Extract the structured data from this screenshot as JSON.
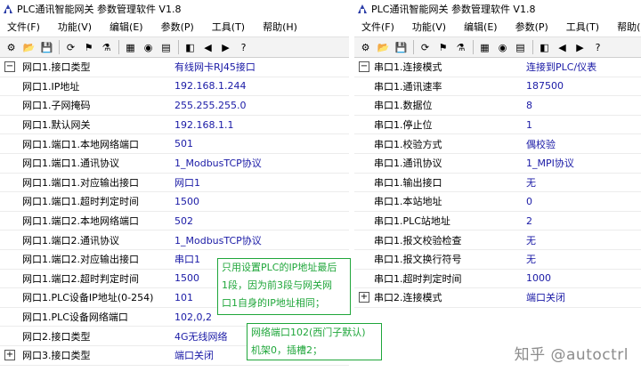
{
  "left": {
    "title": "PLC通讯智能网关 参数管理软件 V1.8",
    "menu": [
      "文件(F)",
      "功能(V)",
      "编辑(E)",
      "参数(P)",
      "工具(T)",
      "帮助(H)"
    ],
    "toolbar": [
      "⚙",
      "📂",
      "💾",
      "⟳",
      "⚑",
      "⚗",
      "▦",
      "◉",
      "▤",
      "◧",
      "◀",
      "▶",
      "?"
    ],
    "rows": [
      {
        "exp": "−",
        "label": "网口1.接口类型",
        "value": "有线网卡RJ45接口"
      },
      {
        "exp": "",
        "label": "网口1.IP地址",
        "value": "192.168.1.244"
      },
      {
        "exp": "",
        "label": "网口1.子网掩码",
        "value": "255.255.255.0"
      },
      {
        "exp": "",
        "label": "网口1.默认网关",
        "value": "192.168.1.1"
      },
      {
        "exp": "",
        "label": "网口1.端口1.本地网络端口",
        "value": "501"
      },
      {
        "exp": "",
        "label": "网口1.端口1.通讯协议",
        "value": "1_ModbusTCP协议"
      },
      {
        "exp": "",
        "label": "网口1.端口1.对应输出接口",
        "value": "网口1"
      },
      {
        "exp": "",
        "label": "网口1.端口1.超时判定时间",
        "value": "1500"
      },
      {
        "exp": "",
        "label": "网口1.端口2.本地网络端口",
        "value": "502"
      },
      {
        "exp": "",
        "label": "网口1.端口2.通讯协议",
        "value": "1_ModbusTCP协议"
      },
      {
        "exp": "",
        "label": "网口1.端口2.对应输出接口",
        "value": "串口1"
      },
      {
        "exp": "",
        "label": "网口1.端口2.超时判定时间",
        "value": "1500"
      },
      {
        "exp": "",
        "label": "网口1.PLC设备IP地址(0-254)",
        "value": "101"
      },
      {
        "exp": "",
        "label": "网口1.PLC设备网络端口",
        "value": "102,0,2"
      },
      {
        "exp": "",
        "label": "网口2.接口类型",
        "value": "4G无线网络"
      },
      {
        "exp": "+",
        "label": "网口3.接口类型",
        "value": "端口关闭"
      }
    ]
  },
  "right": {
    "title": "PLC通讯智能网关 参数管理软件 V1.8",
    "menu": [
      "文件(F)",
      "功能(V)",
      "编辑(E)",
      "参数(P)",
      "工具(T)",
      "帮助(H)"
    ],
    "toolbar": [
      "⚙",
      "📂",
      "💾",
      "⟳",
      "⚑",
      "⚗",
      "▦",
      "◉",
      "▤",
      "◧",
      "◀",
      "▶",
      "?"
    ],
    "rows": [
      {
        "exp": "−",
        "label": "串口1.连接模式",
        "value": "连接到PLC/仪表"
      },
      {
        "exp": "",
        "label": "串口1.通讯速率",
        "value": "187500"
      },
      {
        "exp": "",
        "label": "串口1.数据位",
        "value": "8"
      },
      {
        "exp": "",
        "label": "串口1.停止位",
        "value": "1"
      },
      {
        "exp": "",
        "label": "串口1.校验方式",
        "value": "偶校验"
      },
      {
        "exp": "",
        "label": "串口1.通讯协议",
        "value": "1_MPI协议"
      },
      {
        "exp": "",
        "label": "串口1.输出接口",
        "value": "无"
      },
      {
        "exp": "",
        "label": "串口1.本站地址",
        "value": "0"
      },
      {
        "exp": "",
        "label": "串口1.PLC站地址",
        "value": "2"
      },
      {
        "exp": "",
        "label": "串口1.报文校验检查",
        "value": "无"
      },
      {
        "exp": "",
        "label": "串口1.报文换行符号",
        "value": "无"
      },
      {
        "exp": "",
        "label": "串口1.超时判定时间",
        "value": "1000"
      },
      {
        "exp": "+",
        "label": "串口2.连接模式",
        "value": "端口关闭"
      }
    ]
  },
  "callouts": {
    "ip": [
      "只用设置PLC的IP地址最后",
      "1段，因为前3段与网关网",
      "口1自身的IP地址相同；"
    ],
    "port": [
      "网络端口102(西门子默认)",
      "机架0，插槽2；"
    ]
  },
  "watermark": "知乎 @autoctrl",
  "colors": {
    "value_text": "#1a1aa6",
    "callout_green": "#1fa63a"
  }
}
